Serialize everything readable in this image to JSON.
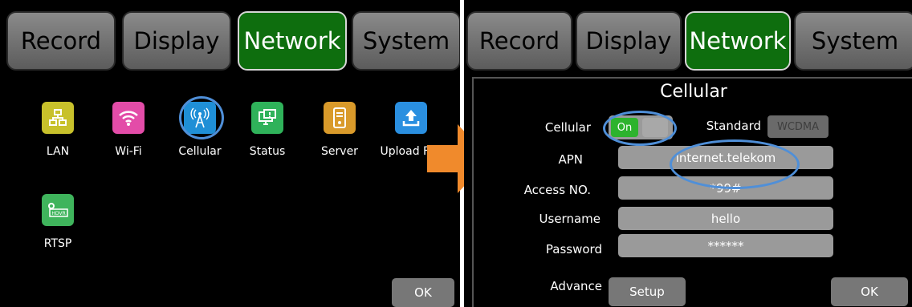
{
  "left": {
    "tabs": [
      "Record",
      "Display",
      "Network",
      "System"
    ],
    "apps": [
      {
        "label": "LAN",
        "icon": "lan-icon",
        "color": "#c8c12b"
      },
      {
        "label": "Wi-Fi",
        "icon": "wifi-icon",
        "color": "#e34ca8"
      },
      {
        "label": "Cellular",
        "icon": "cellular-antenna-icon",
        "color": "#1f8fd6"
      },
      {
        "label": "Status",
        "icon": "status-monitor-icon",
        "color": "#2fb25a"
      },
      {
        "label": "Server",
        "icon": "server-icon",
        "color": "#d99a2a"
      },
      {
        "label": "Upload File",
        "icon": "upload-icon",
        "color": "#2a8fe0"
      },
      {
        "label": "RTSP",
        "icon": "rtsp-icon",
        "color": "#3fb45c"
      }
    ],
    "ok_label": "OK"
  },
  "right": {
    "tabs": [
      "Record",
      "Display",
      "Network",
      "System"
    ],
    "title": "Cellular",
    "cellular_label": "Cellular",
    "toggle_on_label": "On",
    "standard_label": "Standard",
    "standard_value": "WCDMA",
    "fields": [
      {
        "label": "APN",
        "value": "internet.telekom"
      },
      {
        "label": "Access NO.",
        "value": "*99#"
      },
      {
        "label": "Username",
        "value": "hello"
      },
      {
        "label": "Password",
        "value": "******"
      }
    ],
    "advance_label": "Advance",
    "setup_label": "Setup",
    "ok_label": "OK"
  },
  "colors": {
    "active_tab": "#0e6e0e",
    "highlight_ring": "#4f8fd8",
    "arrow": "#f08a2c"
  }
}
